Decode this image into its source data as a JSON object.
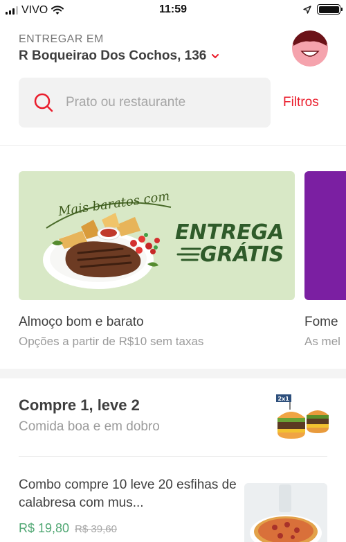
{
  "status_bar": {
    "carrier": "VIVO",
    "time": "11:59"
  },
  "header": {
    "address_label": "ENTREGAR EM",
    "address": "R Boqueirao Dos Cochos, 136"
  },
  "search": {
    "placeholder": "Prato ou restaurante",
    "filters_label": "Filtros"
  },
  "banners": [
    {
      "headline_script": "Mais baratos com",
      "headline_1": "ENTREGA",
      "headline_2": "GRÁTIS",
      "title": "Almoço bom e barato",
      "subtitle": "Opções a partir de R$10 sem taxas"
    },
    {
      "title": "Fome",
      "subtitle": "As mel"
    }
  ],
  "section": {
    "title": "Compre 1, leve 2",
    "subtitle": "Comida boa e em dobro",
    "badge": "2x1"
  },
  "item": {
    "name": "Combo compre 10 leve 20 esfihas de calabresa com mus...",
    "price": "R$ 19,80",
    "old_price": "R$ 39,60"
  },
  "colors": {
    "accent": "#ea1d2c",
    "price_green": "#50a773",
    "banner_green": "#d8e8c6",
    "banner_purple": "#7b1fa2"
  }
}
